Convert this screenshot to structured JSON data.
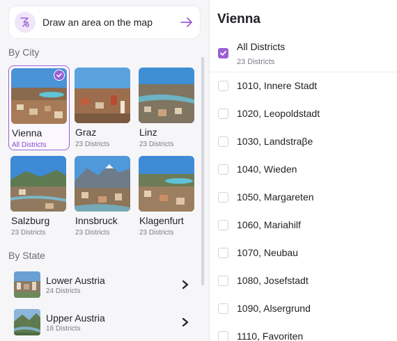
{
  "draw": {
    "label": "Draw an area on the map",
    "icon": "draw-area-icon",
    "arrow_icon": "arrow-right-icon"
  },
  "sections": {
    "by_city": "By City",
    "by_state": "By State"
  },
  "cities": [
    {
      "name": "Vienna",
      "count": "All Districts",
      "selected": true
    },
    {
      "name": "Graz",
      "count": "23 Districts",
      "selected": false
    },
    {
      "name": "Linz",
      "count": "23 Districts",
      "selected": false
    },
    {
      "name": "Salzburg",
      "count": "23 Districts",
      "selected": false
    },
    {
      "name": "Innsbruck",
      "count": "23 Districts",
      "selected": false
    },
    {
      "name": "Klagenfurt",
      "count": "23 Districts",
      "selected": false
    }
  ],
  "states": [
    {
      "name": "Lower Austria",
      "count": "24 Districts"
    },
    {
      "name": "Upper Austria",
      "count": "18 Districts"
    }
  ],
  "panel": {
    "title": "Vienna",
    "all": {
      "label": "All Districts",
      "count": "23 Districts",
      "checked": true
    },
    "districts": [
      "1010, Innere Stadt",
      "1020, Leopoldstadt",
      "1030, Landstraβe",
      "1040, Wieden",
      "1050, Margareten",
      "1060, Mariahilf",
      "1070, Neubau",
      "1080, Josefstadt",
      "1090, Alsergrund",
      "1110, Favoriten"
    ]
  },
  "colors": {
    "accent": "#9b5fd6",
    "accent_light": "#efe6fb",
    "text": "#1f1f24",
    "muted": "#7a7a84"
  }
}
